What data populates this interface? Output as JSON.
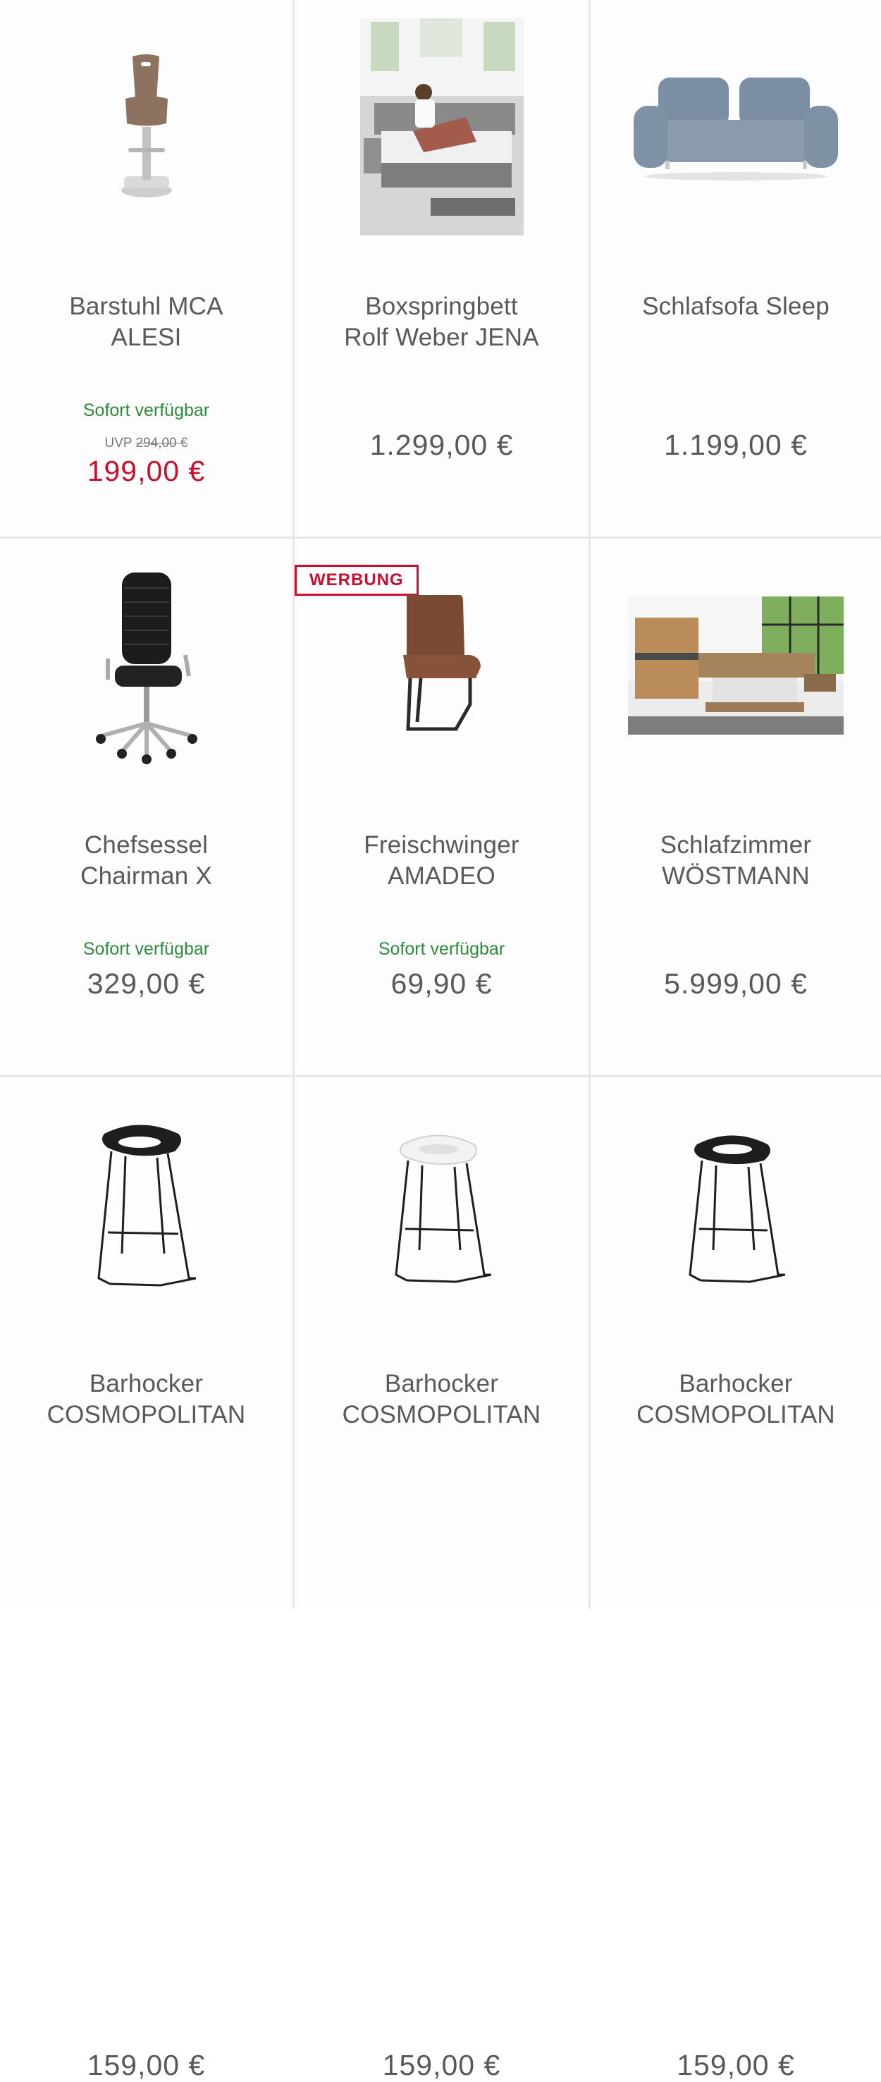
{
  "products": [
    {
      "title": "Barstuhl MCA\nALESI",
      "availability": "Sofort verfügbar",
      "uvp_label": "UVP",
      "uvp_price": "294,00 €",
      "price": "199,00 €"
    },
    {
      "title": "Boxspringbett\nRolf Weber JENA",
      "price": "1.299,00 €"
    },
    {
      "title": "Schlafsofa Sleep",
      "price": "1.199,00 €"
    },
    {
      "title": "Chefsessel\nChairman X",
      "availability": "Sofort verfügbar",
      "price": "329,00 €"
    },
    {
      "badge": "WERBUNG",
      "title": "Freischwinger\nAMADEO",
      "availability": "Sofort verfügbar",
      "price": "69,90 €"
    },
    {
      "title": "Schlafzimmer\nWÖSTMANN",
      "price": "5.999,00 €"
    },
    {
      "title": "Barhocker\nCOSMOPOLITAN",
      "price": "159,00 €"
    },
    {
      "title": "Barhocker\nCOSMOPOLITAN",
      "price": "159,00 €"
    },
    {
      "title": "Barhocker\nCOSMOPOLITAN",
      "price": "159,00 €"
    }
  ],
  "colors": {
    "sale_red": "#c8102e",
    "available_green": "#2e8b3e",
    "text_gray": "#595959"
  }
}
